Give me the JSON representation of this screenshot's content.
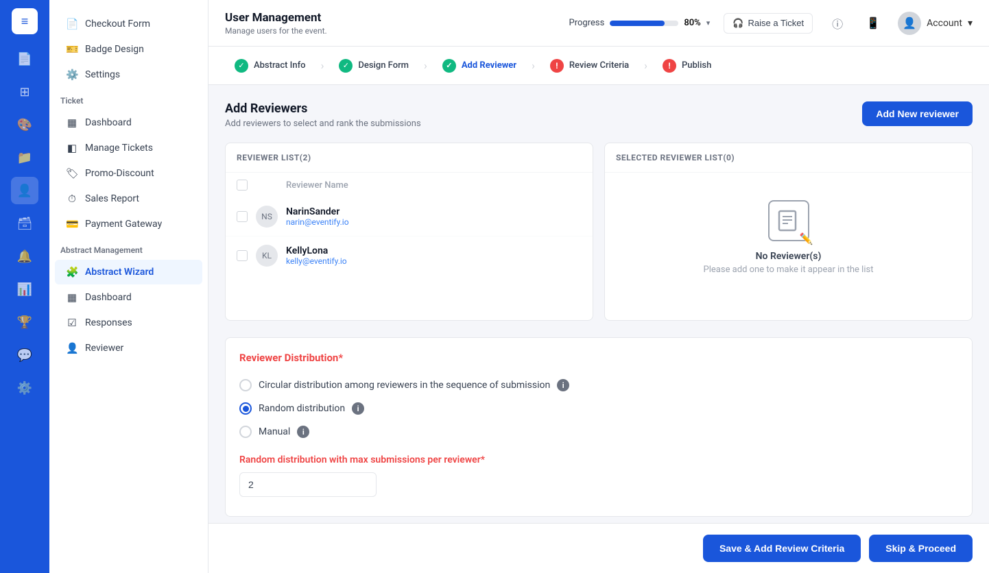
{
  "topbar": {
    "app_title": "User Management",
    "app_subtitle": "Manage users for the event.",
    "progress_label": "Progress",
    "progress_value": "80%",
    "progress_percent": 80,
    "progress_chevron": "▾",
    "raise_ticket_label": "Raise a Ticket",
    "account_label": "Account",
    "account_chevron": "▾"
  },
  "steps": [
    {
      "id": "abstract-info",
      "label": "Abstract Info",
      "status": "done"
    },
    {
      "id": "design-form",
      "label": "Design Form",
      "status": "done"
    },
    {
      "id": "add-reviewer",
      "label": "Add Reviewer",
      "status": "active"
    },
    {
      "id": "review-criteria",
      "label": "Review Criteria",
      "status": "error"
    },
    {
      "id": "publish",
      "label": "Publish",
      "status": "error"
    }
  ],
  "page": {
    "title": "Add Reviewers",
    "subtitle": "Add reviewers to select and rank the submissions",
    "add_reviewer_btn": "Add New reviewer"
  },
  "reviewer_list_panel": {
    "header": "REVIEWER LIST(2)",
    "column_label": "Reviewer Name",
    "reviewers": [
      {
        "name": "NarinSander",
        "email": "narin@eventify.io"
      },
      {
        "name": "KellyLona",
        "email": "kelly@eventify.io"
      }
    ]
  },
  "selected_list_panel": {
    "header": "SELECTED REVIEWER LIST(0)",
    "empty_title": "No Reviewer(s)",
    "empty_subtitle": "Please add one to make it appear in the list"
  },
  "distribution": {
    "title": "Reviewer Distribution",
    "required_marker": "*",
    "options": [
      {
        "id": "circular",
        "label": "Circular distribution among reviewers in the sequence of submission",
        "selected": false,
        "has_info": true
      },
      {
        "id": "random",
        "label": "Random distribution",
        "selected": true,
        "has_info": true
      },
      {
        "id": "manual",
        "label": "Manual",
        "selected": false,
        "has_info": true
      }
    ]
  },
  "max_submissions": {
    "label": "Random distribution with max submissions per reviewer",
    "required_marker": "*",
    "value": "2"
  },
  "footer": {
    "save_btn": "Save & Add Review Criteria",
    "skip_btn": "Skip & Proceed"
  },
  "left_nav": {
    "top_items": [
      {
        "id": "checkout-form",
        "label": "Checkout Form",
        "icon": "📄"
      },
      {
        "id": "badge-design",
        "label": "Badge Design",
        "icon": "🎫"
      },
      {
        "id": "settings",
        "label": "Settings",
        "icon": "⚙️"
      }
    ],
    "ticket_section": "Ticket",
    "ticket_items": [
      {
        "id": "dashboard",
        "label": "Dashboard",
        "icon": "▦"
      },
      {
        "id": "manage-tickets",
        "label": "Manage Tickets",
        "icon": "◧"
      },
      {
        "id": "promo-discount",
        "label": "Promo-Discount",
        "icon": "🏷"
      },
      {
        "id": "sales-report",
        "label": "Sales Report",
        "icon": "⏱"
      },
      {
        "id": "payment-gateway",
        "label": "Payment Gateway",
        "icon": "💳"
      }
    ],
    "abstract_section": "Abstract Management",
    "abstract_items": [
      {
        "id": "abstract-wizard",
        "label": "Abstract Wizard",
        "icon": "🧩",
        "active": true
      },
      {
        "id": "abstract-dashboard",
        "label": "Dashboard",
        "icon": "▦"
      },
      {
        "id": "responses",
        "label": "Responses",
        "icon": "☑"
      },
      {
        "id": "reviewer",
        "label": "Reviewer",
        "icon": "👤"
      }
    ]
  }
}
